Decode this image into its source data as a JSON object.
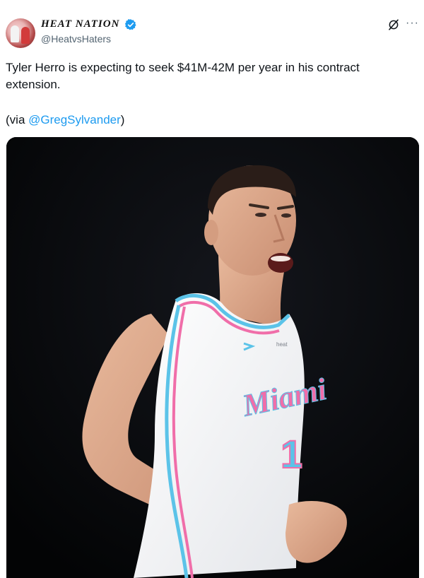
{
  "tweet": {
    "author_name": "HEAT NATION",
    "author_handle": "@HeatvsHaters",
    "text": "Tyler Herro is expecting to seek $41M-42M per year in his contract extension.",
    "via_prefix": "(via ",
    "via_mention": "@GregSylvander",
    "via_suffix": ")",
    "more_label": "···"
  },
  "media": {
    "jersey_text": "Miami",
    "jersey_number": "1",
    "jersey_tag": "heat"
  },
  "colors": {
    "accent": "#1d9bf0",
    "text": "#0f1419",
    "secondary": "#536471",
    "jersey_pink": "#f06ea9",
    "jersey_blue": "#5bc3e8"
  },
  "icons": [
    "verified-badge-icon",
    "grok-icon",
    "more-options-icon"
  ]
}
